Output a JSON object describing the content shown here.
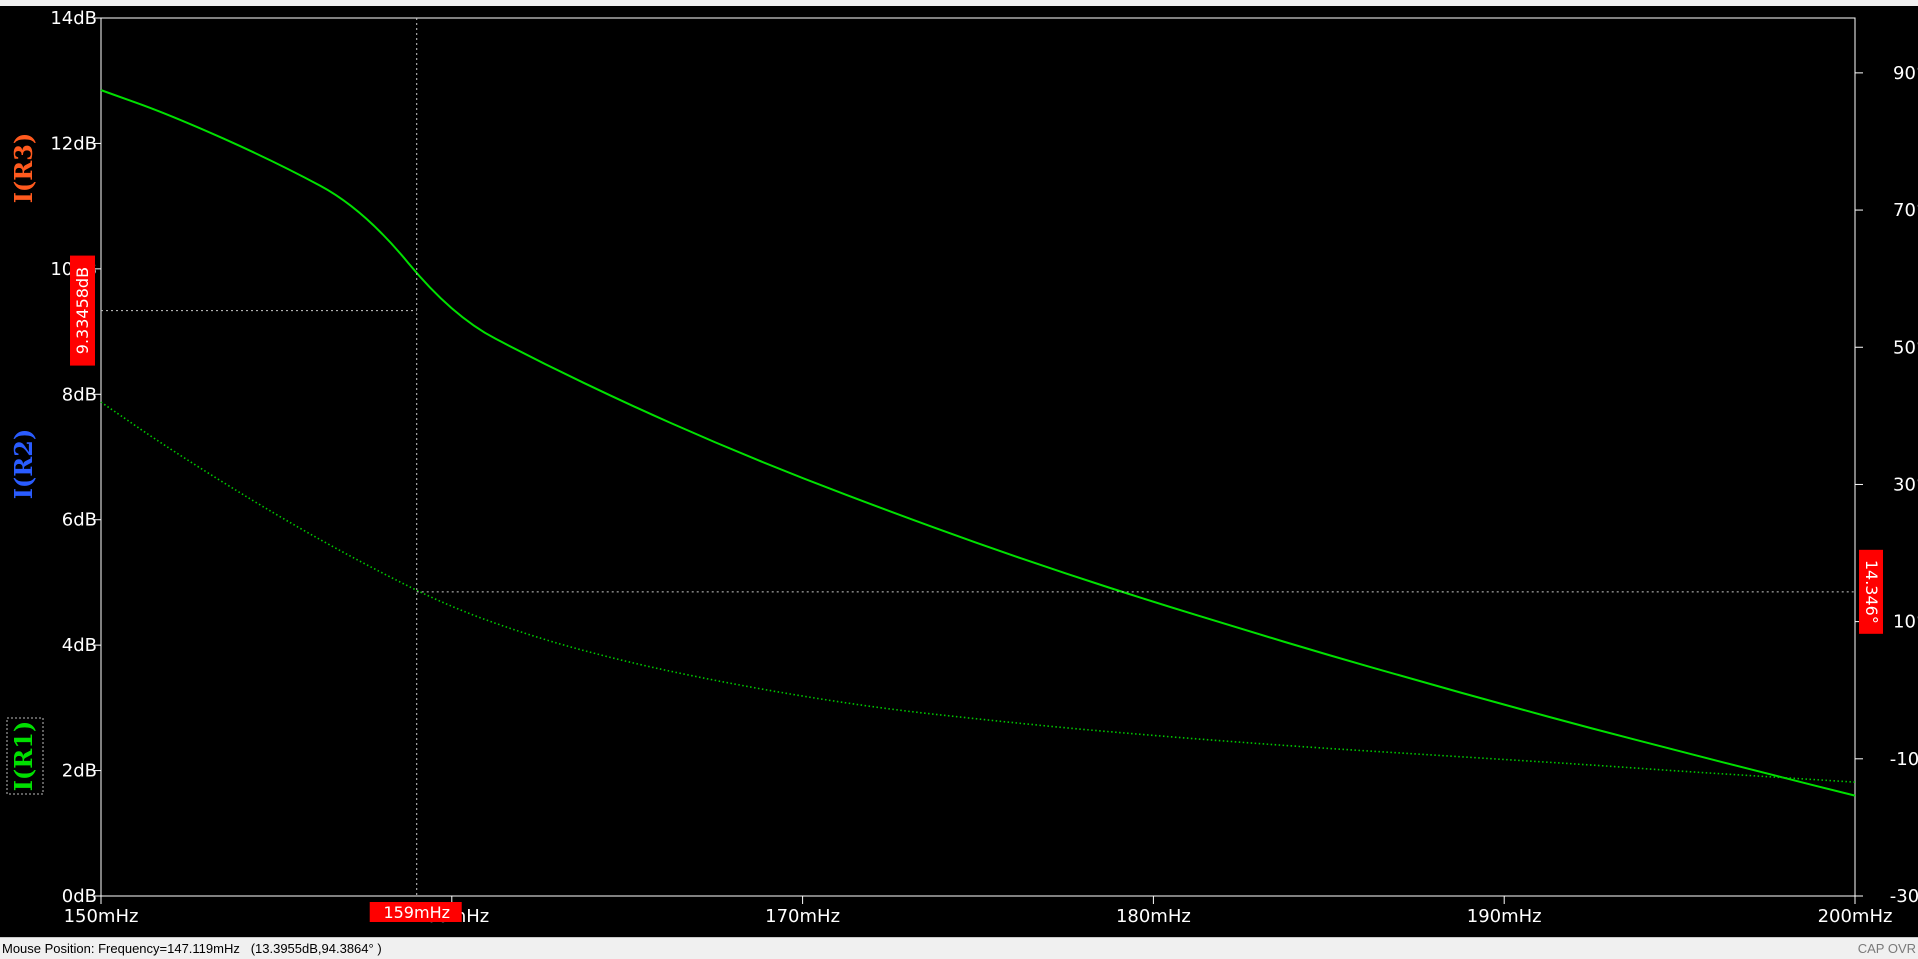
{
  "chart_data": {
    "type": "line",
    "xlim": [
      150,
      200
    ],
    "ylim_left": [
      0,
      14
    ],
    "ylim_right": [
      -30,
      98
    ],
    "x_ticks": [
      {
        "value": 150,
        "label": "150mHz"
      },
      {
        "value": 160,
        "label": "160mHz"
      },
      {
        "value": 170,
        "label": "170mHz"
      },
      {
        "value": 180,
        "label": "180mHz"
      },
      {
        "value": 190,
        "label": "190mHz"
      },
      {
        "value": 200,
        "label": "200mHz"
      }
    ],
    "y_left_ticks": [
      {
        "value": 0,
        "label": "0dB"
      },
      {
        "value": 2,
        "label": "2dB"
      },
      {
        "value": 4,
        "label": "4dB"
      },
      {
        "value": 6,
        "label": "6dB"
      },
      {
        "value": 8,
        "label": "8dB"
      },
      {
        "value": 10,
        "label": "10dB"
      },
      {
        "value": 12,
        "label": "12dB"
      },
      {
        "value": 14,
        "label": "14dB"
      }
    ],
    "y_right_ticks": [
      {
        "value": 90,
        "label": "90°"
      },
      {
        "value": 70,
        "label": "70°"
      },
      {
        "value": 50,
        "label": "50°"
      },
      {
        "value": 30,
        "label": "30°"
      },
      {
        "value": 10,
        "label": "10°"
      },
      {
        "value": -10,
        "label": "-10°"
      },
      {
        "value": -30,
        "label": "-30°"
      }
    ],
    "trace_labels": [
      {
        "text": "I(R3)",
        "color": "#ff5a1e"
      },
      {
        "text": "I(R2)",
        "color": "#2a5cff"
      },
      {
        "text": "I(R1)",
        "color": "#00e000"
      }
    ],
    "series": [
      {
        "axis": "left",
        "style": "solid",
        "color": "#00e000",
        "x": [
          150,
          152,
          155,
          157.5,
          160,
          162.5,
          165,
          167.5,
          170,
          172.5,
          175,
          177.5,
          180,
          182.5,
          185,
          187.5,
          190,
          192.5,
          195,
          197.5,
          200
        ],
        "y": [
          12.85,
          12.45,
          11.7,
          10.95,
          9.25,
          8.52,
          7.85,
          7.23,
          6.66,
          6.13,
          5.62,
          5.14,
          4.69,
          4.26,
          3.84,
          3.44,
          3.05,
          2.67,
          2.31,
          1.95,
          1.6
        ]
      },
      {
        "axis": "right",
        "style": "dotted",
        "color": "#00c800",
        "x": [
          150,
          152,
          155,
          157.5,
          160,
          162.5,
          165,
          167.5,
          170,
          172.5,
          175,
          177.5,
          180,
          182.5,
          185,
          187.5,
          190,
          192.5,
          195,
          197.5,
          200
        ],
        "y": [
          42,
          35,
          25.5,
          18.4,
          12,
          7.5,
          4.1,
          1.4,
          -0.9,
          -2.8,
          -4.2,
          -5.5,
          -6.6,
          -7.6,
          -8.5,
          -9.3,
          -10.1,
          -10.9,
          -11.8,
          -12.6,
          -13.4
        ]
      }
    ],
    "cursor": {
      "x": 159,
      "x_label": "159mHz",
      "y_left": 9.33458,
      "y_left_label": "9.33458dB",
      "y_right": 14.346,
      "y_right_label": "14.346°"
    },
    "colors": {
      "background": "#000000",
      "axis": "#ffffff",
      "cursor_flag": "#ff0000",
      "cursor_line": "#c8c8c8"
    }
  },
  "status": {
    "mouse_position": "Mouse Position: Frequency=147.119mHz   (13.3955dB,94.3864° )",
    "indicators": "CAP OVR"
  }
}
